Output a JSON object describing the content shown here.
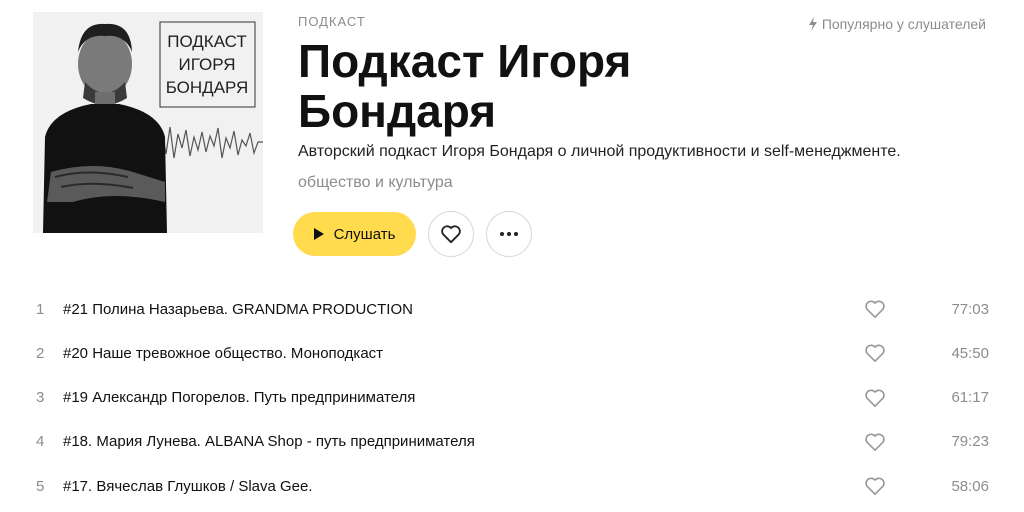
{
  "podcast": {
    "kind": "ПОДКАСТ",
    "popular_label": "Популярно у слушателей",
    "title": "Подкаст Игоря Бондаря",
    "description": "Авторский подкаст Игоря Бондаря о личной продуктивности и self-менеджменте.",
    "genre": "общество и культура",
    "cover_text": [
      "ПОДКАСТ",
      "ИГОРЯ",
      "БОНДАРЯ"
    ]
  },
  "actions": {
    "play_label": "Слушать",
    "like_icon": "heart-icon",
    "more_icon": "more-dots-icon"
  },
  "colors": {
    "accent": "#ffdb4d",
    "muted": "#8c8c8c"
  },
  "tracks": [
    {
      "number": "1",
      "title": "#21 Полина Назарьева. GRANDMA PRODUCTION",
      "duration": "77:03"
    },
    {
      "number": "2",
      "title": "#20 Наше тревожное общество. Моноподкаст",
      "duration": "45:50"
    },
    {
      "number": "3",
      "title": "#19 Александр Погорелов. Путь предпринимателя",
      "duration": "61:17"
    },
    {
      "number": "4",
      "title": "#18. Мария Лунева. ALBANA Shop - путь предпринимателя",
      "duration": "79:23"
    },
    {
      "number": "5",
      "title": "#17. Вячеслав Глушков / Slava Gee.",
      "duration": "58:06"
    }
  ]
}
